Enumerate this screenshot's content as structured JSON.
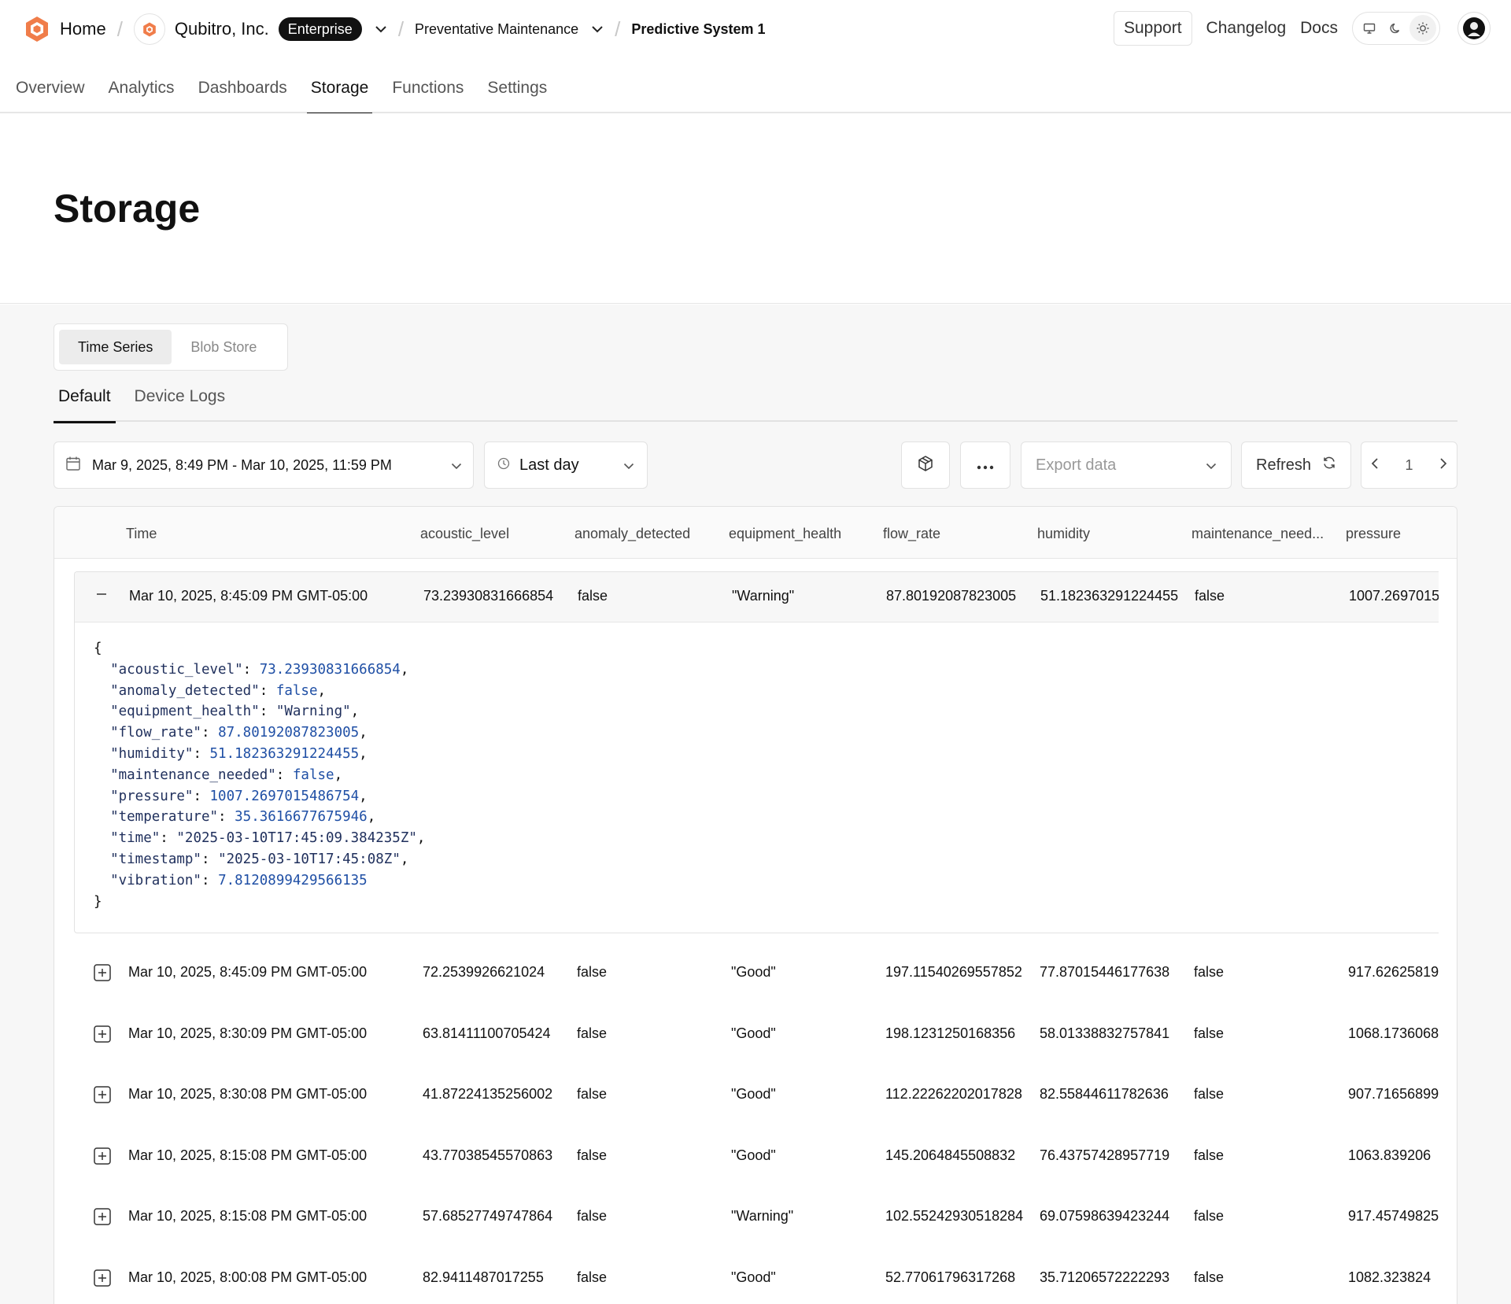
{
  "header": {
    "home_label": "Home",
    "org_name": "Qubitro, Inc.",
    "org_badge": "Enterprise",
    "project": "Preventative Maintenance",
    "system": "Predictive System 1",
    "support": "Support",
    "changelog": "Changelog",
    "docs": "Docs"
  },
  "colors": {
    "brand": "#f07d4a",
    "active_tab": "#111111",
    "json_key": "#1f2f5c",
    "json_value": "#1f4fa5"
  },
  "nav": {
    "tabs": [
      "Overview",
      "Analytics",
      "Dashboards",
      "Storage",
      "Functions",
      "Settings"
    ],
    "active": "Storage"
  },
  "page": {
    "title": "Storage"
  },
  "segment": {
    "time_series": "Time Series",
    "blob_store": "Blob Store"
  },
  "subtabs": {
    "default": "Default",
    "device_logs": "Device Logs"
  },
  "toolbar": {
    "date_range": "Mar 9, 2025, 8:49 PM - Mar 10, 2025, 11:59 PM",
    "range_preset": "Last day",
    "export_placeholder": "Export data",
    "refresh": "Refresh",
    "page": "1"
  },
  "table": {
    "columns": [
      "Time",
      "acoustic_level",
      "anomaly_detected",
      "equipment_health",
      "flow_rate",
      "humidity",
      "maintenance_need...",
      "pressure"
    ],
    "expanded_row": {
      "time": "Mar 10, 2025, 8:45:09 PM GMT-05:00",
      "acoustic_level": "73.23930831666854",
      "anomaly_detected": "false",
      "equipment_health": "\"Warning\"",
      "flow_rate": "87.80192087823005",
      "humidity": "51.182363291224455",
      "maintenance_needed": "false",
      "pressure": "1007.2697015"
    },
    "json_lines": [
      {
        "key": "\"acoustic_level\"",
        "value": "73.23930831666854",
        "value_type": "num",
        "comma": ","
      },
      {
        "key": "\"anomaly_detected\"",
        "value": "false",
        "value_type": "num",
        "comma": ","
      },
      {
        "key": "\"equipment_health\"",
        "value": "\"Warning\"",
        "value_type": "str",
        "comma": ","
      },
      {
        "key": "\"flow_rate\"",
        "value": "87.80192087823005",
        "value_type": "num",
        "comma": ","
      },
      {
        "key": "\"humidity\"",
        "value": "51.182363291224455",
        "value_type": "num",
        "comma": ","
      },
      {
        "key": "\"maintenance_needed\"",
        "value": "false",
        "value_type": "num",
        "comma": ","
      },
      {
        "key": "\"pressure\"",
        "value": "1007.2697015486754",
        "value_type": "num",
        "comma": ","
      },
      {
        "key": "\"temperature\"",
        "value": "35.3616677675946",
        "value_type": "num",
        "comma": ","
      },
      {
        "key": "\"time\"",
        "value": "\"2025-03-10T17:45:09.384235Z\"",
        "value_type": "str",
        "comma": ","
      },
      {
        "key": "\"timestamp\"",
        "value": "\"2025-03-10T17:45:08Z\"",
        "value_type": "str",
        "comma": ","
      },
      {
        "key": "\"vibration\"",
        "value": "7.8120899429566135",
        "value_type": "num",
        "comma": ""
      }
    ],
    "rows": [
      {
        "time": "Mar 10, 2025, 8:45:09 PM GMT-05:00",
        "acoustic_level": "72.2539926621024",
        "anomaly_detected": "false",
        "equipment_health": "\"Good\"",
        "flow_rate": "197.11540269557852",
        "humidity": "77.87015446177638",
        "maintenance_needed": "false",
        "pressure": "917.62625819"
      },
      {
        "time": "Mar 10, 2025, 8:30:09 PM GMT-05:00",
        "acoustic_level": "63.81411100705424",
        "anomaly_detected": "false",
        "equipment_health": "\"Good\"",
        "flow_rate": "198.1231250168356",
        "humidity": "58.01338832757841",
        "maintenance_needed": "false",
        "pressure": "1068.1736068"
      },
      {
        "time": "Mar 10, 2025, 8:30:08 PM GMT-05:00",
        "acoustic_level": "41.87224135256002",
        "anomaly_detected": "false",
        "equipment_health": "\"Good\"",
        "flow_rate": "112.22262202017828",
        "humidity": "82.55844611782636",
        "maintenance_needed": "false",
        "pressure": "907.71656899"
      },
      {
        "time": "Mar 10, 2025, 8:15:08 PM GMT-05:00",
        "acoustic_level": "43.77038545570863",
        "anomaly_detected": "false",
        "equipment_health": "\"Good\"",
        "flow_rate": "145.2064845508832",
        "humidity": "76.43757428957719",
        "maintenance_needed": "false",
        "pressure": "1063.839206"
      },
      {
        "time": "Mar 10, 2025, 8:15:08 PM GMT-05:00",
        "acoustic_level": "57.68527749747864",
        "anomaly_detected": "false",
        "equipment_health": "\"Warning\"",
        "flow_rate": "102.55242930518284",
        "humidity": "69.07598639423244",
        "maintenance_needed": "false",
        "pressure": "917.45749825"
      },
      {
        "time": "Mar 10, 2025, 8:00:08 PM GMT-05:00",
        "acoustic_level": "82.9411487017255",
        "anomaly_detected": "false",
        "equipment_health": "\"Good\"",
        "flow_rate": "52.77061796317268",
        "humidity": "35.71206572222293",
        "maintenance_needed": "false",
        "pressure": "1082.323824"
      }
    ]
  }
}
